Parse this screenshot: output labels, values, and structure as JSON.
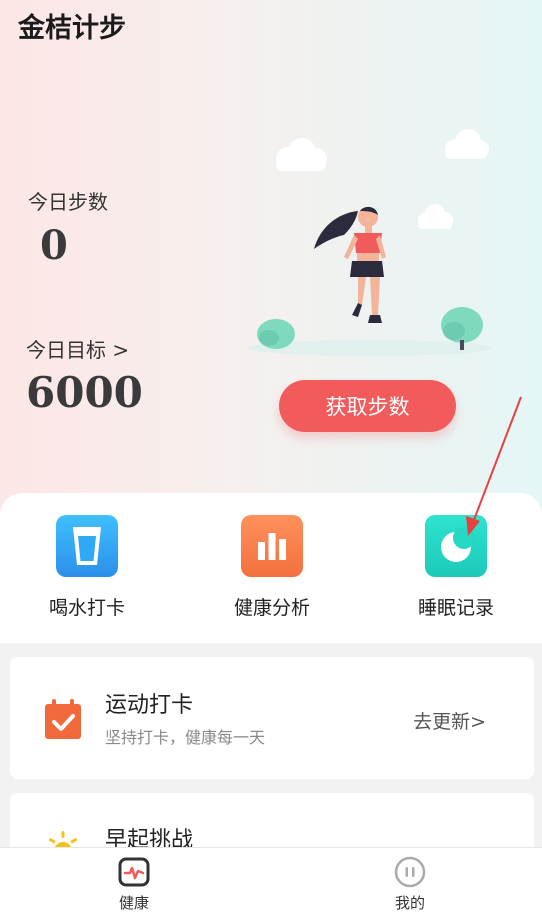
{
  "app": {
    "title": "金桔计步"
  },
  "stats": {
    "steps_label": "今日步数",
    "steps_value": "0",
    "goal_label": "今日目标 >",
    "goal_value": "6000"
  },
  "cta": {
    "label": "获取步数"
  },
  "quick_actions": [
    {
      "label": "喝水打卡",
      "icon": "water-cup-icon",
      "color": "#2fa8f5"
    },
    {
      "label": "健康分析",
      "icon": "bar-chart-icon",
      "color": "#f47a4a"
    },
    {
      "label": "睡眠记录",
      "icon": "moon-icon",
      "color": "#25d8c5"
    }
  ],
  "cards": [
    {
      "title": "运动打卡",
      "subtitle": "坚持打卡，健康每一天",
      "action": "去更新>",
      "icon": "calendar-check-icon",
      "color": "#f26a3c"
    },
    {
      "title": "早起挑战",
      "icon": "sun-icon",
      "color": "#f5c21b"
    }
  ],
  "tabbar": [
    {
      "label": "健康",
      "icon": "health-monitor-icon"
    },
    {
      "label": "我的",
      "icon": "profile-icon"
    }
  ],
  "colors": {
    "accent": "#f25b5b",
    "annotation": "#e84040"
  }
}
